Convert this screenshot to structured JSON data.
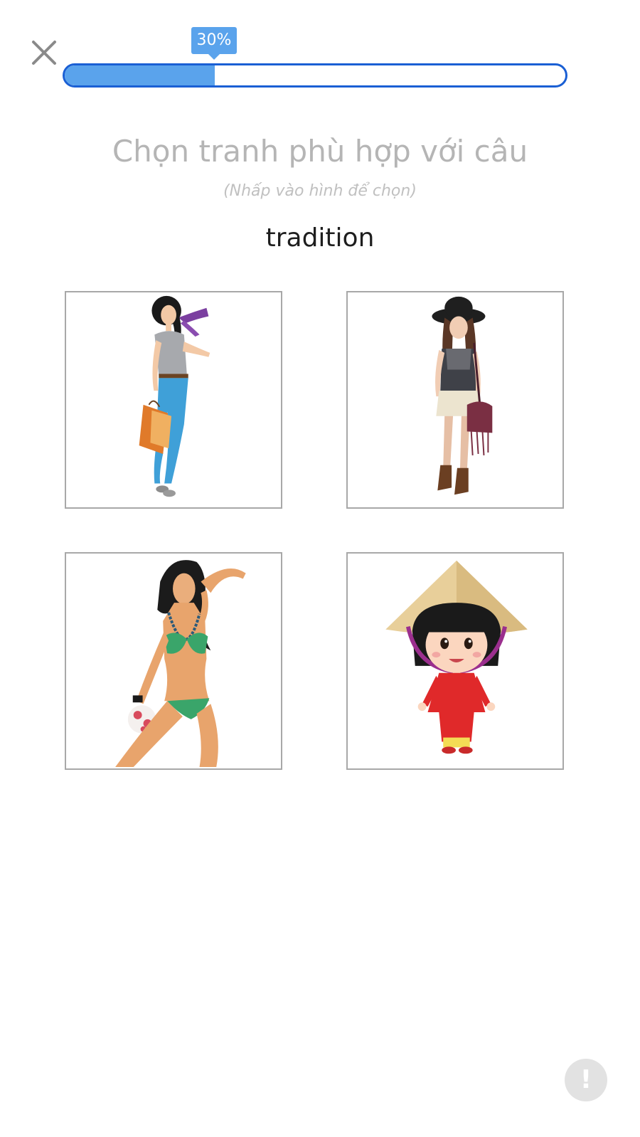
{
  "header": {
    "close_icon": "close-icon",
    "progress": {
      "percent": 30,
      "label": "30%",
      "fill_color": "#5aa3ec",
      "border_color": "#1a5fd4"
    }
  },
  "question": {
    "title": "Chọn tranh phù hợp với câu",
    "hint": "(Nhấp vào hình để chọn)",
    "word": "tradition"
  },
  "options": [
    {
      "icon": "shopping-woman-illustration"
    },
    {
      "icon": "boho-woman-illustration"
    },
    {
      "icon": "bikini-woman-illustration"
    },
    {
      "icon": "vietnamese-ao-dai-girl-illustration"
    }
  ],
  "footer": {
    "report_label": "!",
    "report_icon": "exclamation-icon"
  }
}
